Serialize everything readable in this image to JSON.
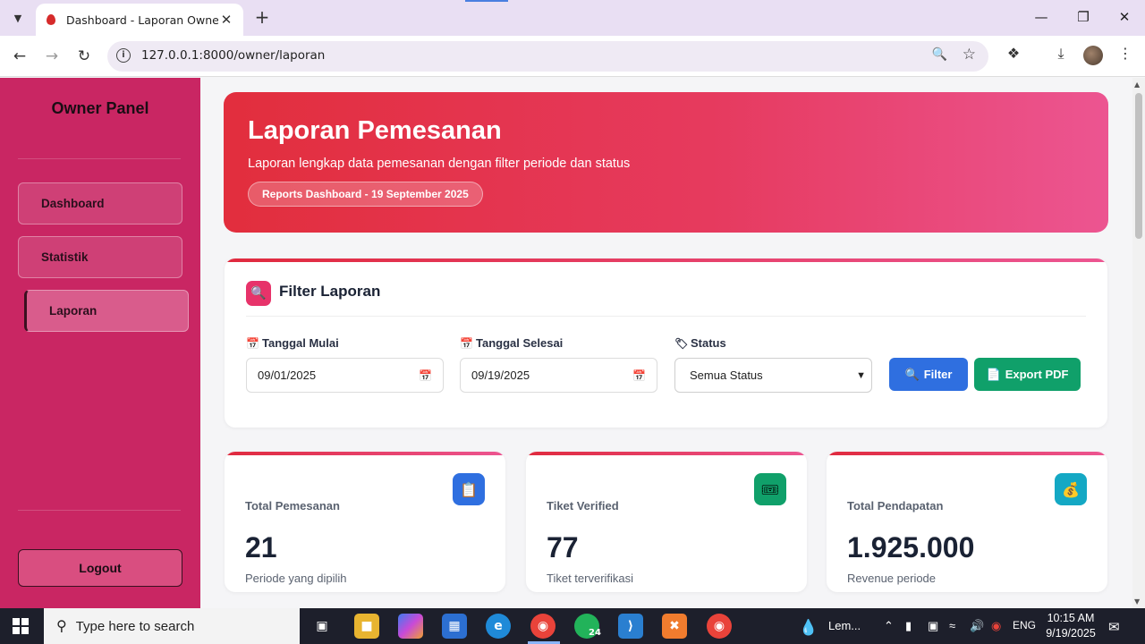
{
  "browser": {
    "tab_title": "Dashboard - Laporan Owner",
    "url": "127.0.0.1:8000/owner/laporan"
  },
  "sidebar": {
    "brand": "Owner Panel",
    "items": [
      {
        "label": "Dashboard"
      },
      {
        "label": "Statistik"
      },
      {
        "label": "Laporan"
      }
    ],
    "logout": "Logout"
  },
  "hero": {
    "title": "Laporan Pemesanan",
    "subtitle": "Laporan lengkap data pemesanan dengan filter periode dan status",
    "pill": "Reports Dashboard - 19 September 2025"
  },
  "filter": {
    "title": "Filter Laporan",
    "start_label": "Tanggal Mulai",
    "start_value": "09/01/2025",
    "end_label": "Tanggal Selesai",
    "end_value": "09/19/2025",
    "status_label": "Status",
    "status_value": "Semua Status",
    "filter_button": "Filter",
    "export_button": "Export PDF"
  },
  "stats": [
    {
      "label": "Total Pemesanan",
      "value": "21",
      "note": "Periode yang dipilih",
      "icon": "clipboard-icon",
      "color": "#2f6fe0"
    },
    {
      "label": "Tiket Verified",
      "value": "77",
      "note": "Tiket terverifikasi",
      "icon": "ticket-icon",
      "color": "#10a06a"
    },
    {
      "label": "Total Pendapatan",
      "value": "1.925.000",
      "note": "Revenue periode",
      "icon": "money-bag-icon",
      "color": "#14a8c4"
    }
  ],
  "taskbar": {
    "search_placeholder": "Type here to search",
    "whatsapp_badge": "24",
    "weather": "Lem...",
    "language": "ENG",
    "time": "10:15 AM",
    "date": "9/19/2025"
  }
}
